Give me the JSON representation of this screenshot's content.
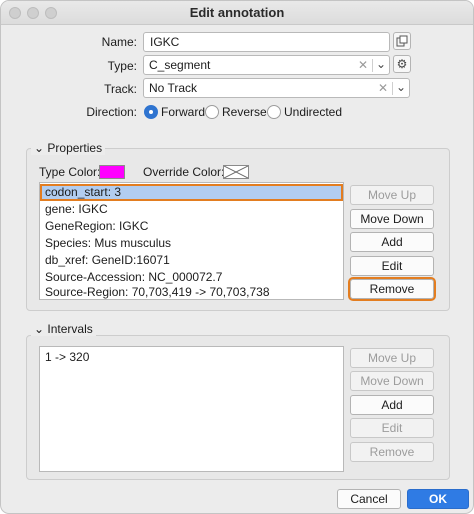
{
  "window": {
    "title": "Edit annotation"
  },
  "name": {
    "label": "Name:",
    "value": "IGKC"
  },
  "type": {
    "label": "Type:",
    "value": "C_segment"
  },
  "track": {
    "label": "Track:",
    "value": "No Track"
  },
  "direction": {
    "label": "Direction:",
    "options": [
      "Forward",
      "Reverse",
      "Undirected"
    ],
    "selected": "Forward"
  },
  "properties": {
    "title": "Properties",
    "type_color_label": "Type Color:",
    "type_color": "#ff00ff",
    "override_color_label": "Override Color:",
    "items": [
      "codon_start: 3",
      "gene: IGKC",
      "GeneRegion: IGKC",
      "Species: Mus musculus",
      "db_xref: GeneID:16071",
      "Source-Accession: NC_000072.7",
      "Source-Region: 70,703,419 -> 70,703,738"
    ],
    "buttons": {
      "move_up": "Move Up",
      "move_down": "Move Down",
      "add": "Add",
      "edit": "Edit",
      "remove": "Remove"
    }
  },
  "intervals": {
    "title": "Intervals",
    "items": [
      "1 -> 320"
    ],
    "buttons": {
      "move_up": "Move Up",
      "move_down": "Move Down",
      "add": "Add",
      "edit": "Edit",
      "remove": "Remove"
    }
  },
  "footer": {
    "cancel": "Cancel",
    "ok": "OK"
  },
  "colors": {
    "accent": "#2f7be4",
    "focus": "#e37d20",
    "selection": "#b2cdf0"
  }
}
